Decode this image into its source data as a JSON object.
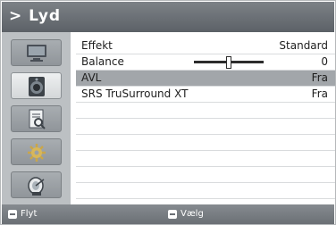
{
  "header": {
    "title": "> Lyd"
  },
  "sidebar": {
    "items": [
      {
        "icon": "tv-icon",
        "active": false
      },
      {
        "icon": "speaker-icon",
        "active": true
      },
      {
        "icon": "document-search-icon",
        "active": false
      },
      {
        "icon": "gear-icon",
        "active": false
      },
      {
        "icon": "satellite-icon",
        "active": false
      }
    ]
  },
  "menu": {
    "rows": [
      {
        "label": "Effekt",
        "value": "Standard"
      },
      {
        "label": "Balance",
        "value": "0",
        "slider_fraction": 0.5
      },
      {
        "label": "AVL",
        "value": "Fra",
        "selected": true
      },
      {
        "label": "SRS TruSurround XT",
        "value": "Fra"
      }
    ]
  },
  "footer": {
    "move_label": "Flyt",
    "select_label": "Vælg"
  },
  "colors": {
    "selected_row": "#a2a6aa",
    "header": "#6b7075",
    "sidebar": "#bcc0c3"
  }
}
